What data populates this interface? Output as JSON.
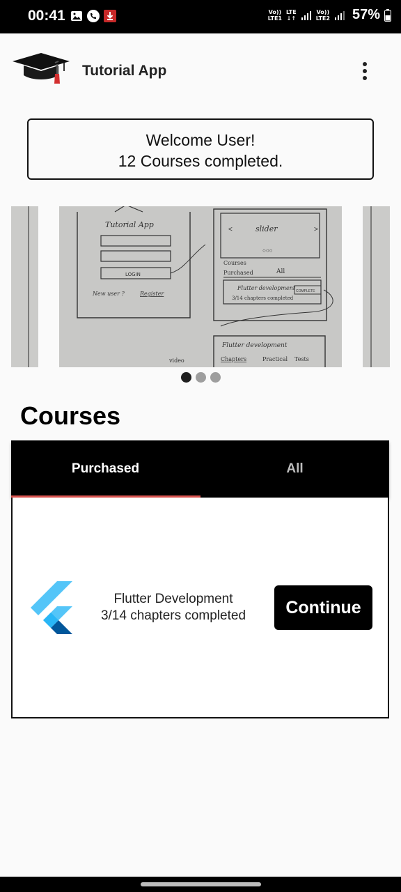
{
  "status_bar": {
    "time": "00:41",
    "sim1": [
      "Vo))",
      "LTE1"
    ],
    "lte_label": "LTE",
    "sim2": [
      "Vo))",
      "LTE2"
    ],
    "battery": "57%"
  },
  "app_bar": {
    "title": "Tutorial App",
    "logo_icon": "graduation-cap-icon",
    "menu_icon": "more-vert-icon"
  },
  "welcome": {
    "line1": "Welcome User!",
    "line2": "12 Courses completed."
  },
  "carousel": {
    "slide_count": 3,
    "active_index": 0,
    "sketch_labels": [
      "Tutorial App",
      "slider",
      "Courses",
      "Purchased",
      "All",
      "Flutter development",
      "3/14 chapters completed",
      "COMPLETE",
      "LOGIN",
      "New user ?",
      "Register",
      "Flutter development",
      "Chapters",
      "Practical",
      "Tests",
      "video"
    ]
  },
  "courses": {
    "title": "Courses",
    "tabs": [
      {
        "label": "Purchased",
        "selected": true
      },
      {
        "label": "All",
        "selected": false
      }
    ],
    "indicator_color": "#d9534f",
    "items": [
      {
        "icon": "flutter-logo-icon",
        "name": "Flutter Development",
        "progress": "3/14 chapters completed",
        "action": "Continue"
      }
    ]
  }
}
